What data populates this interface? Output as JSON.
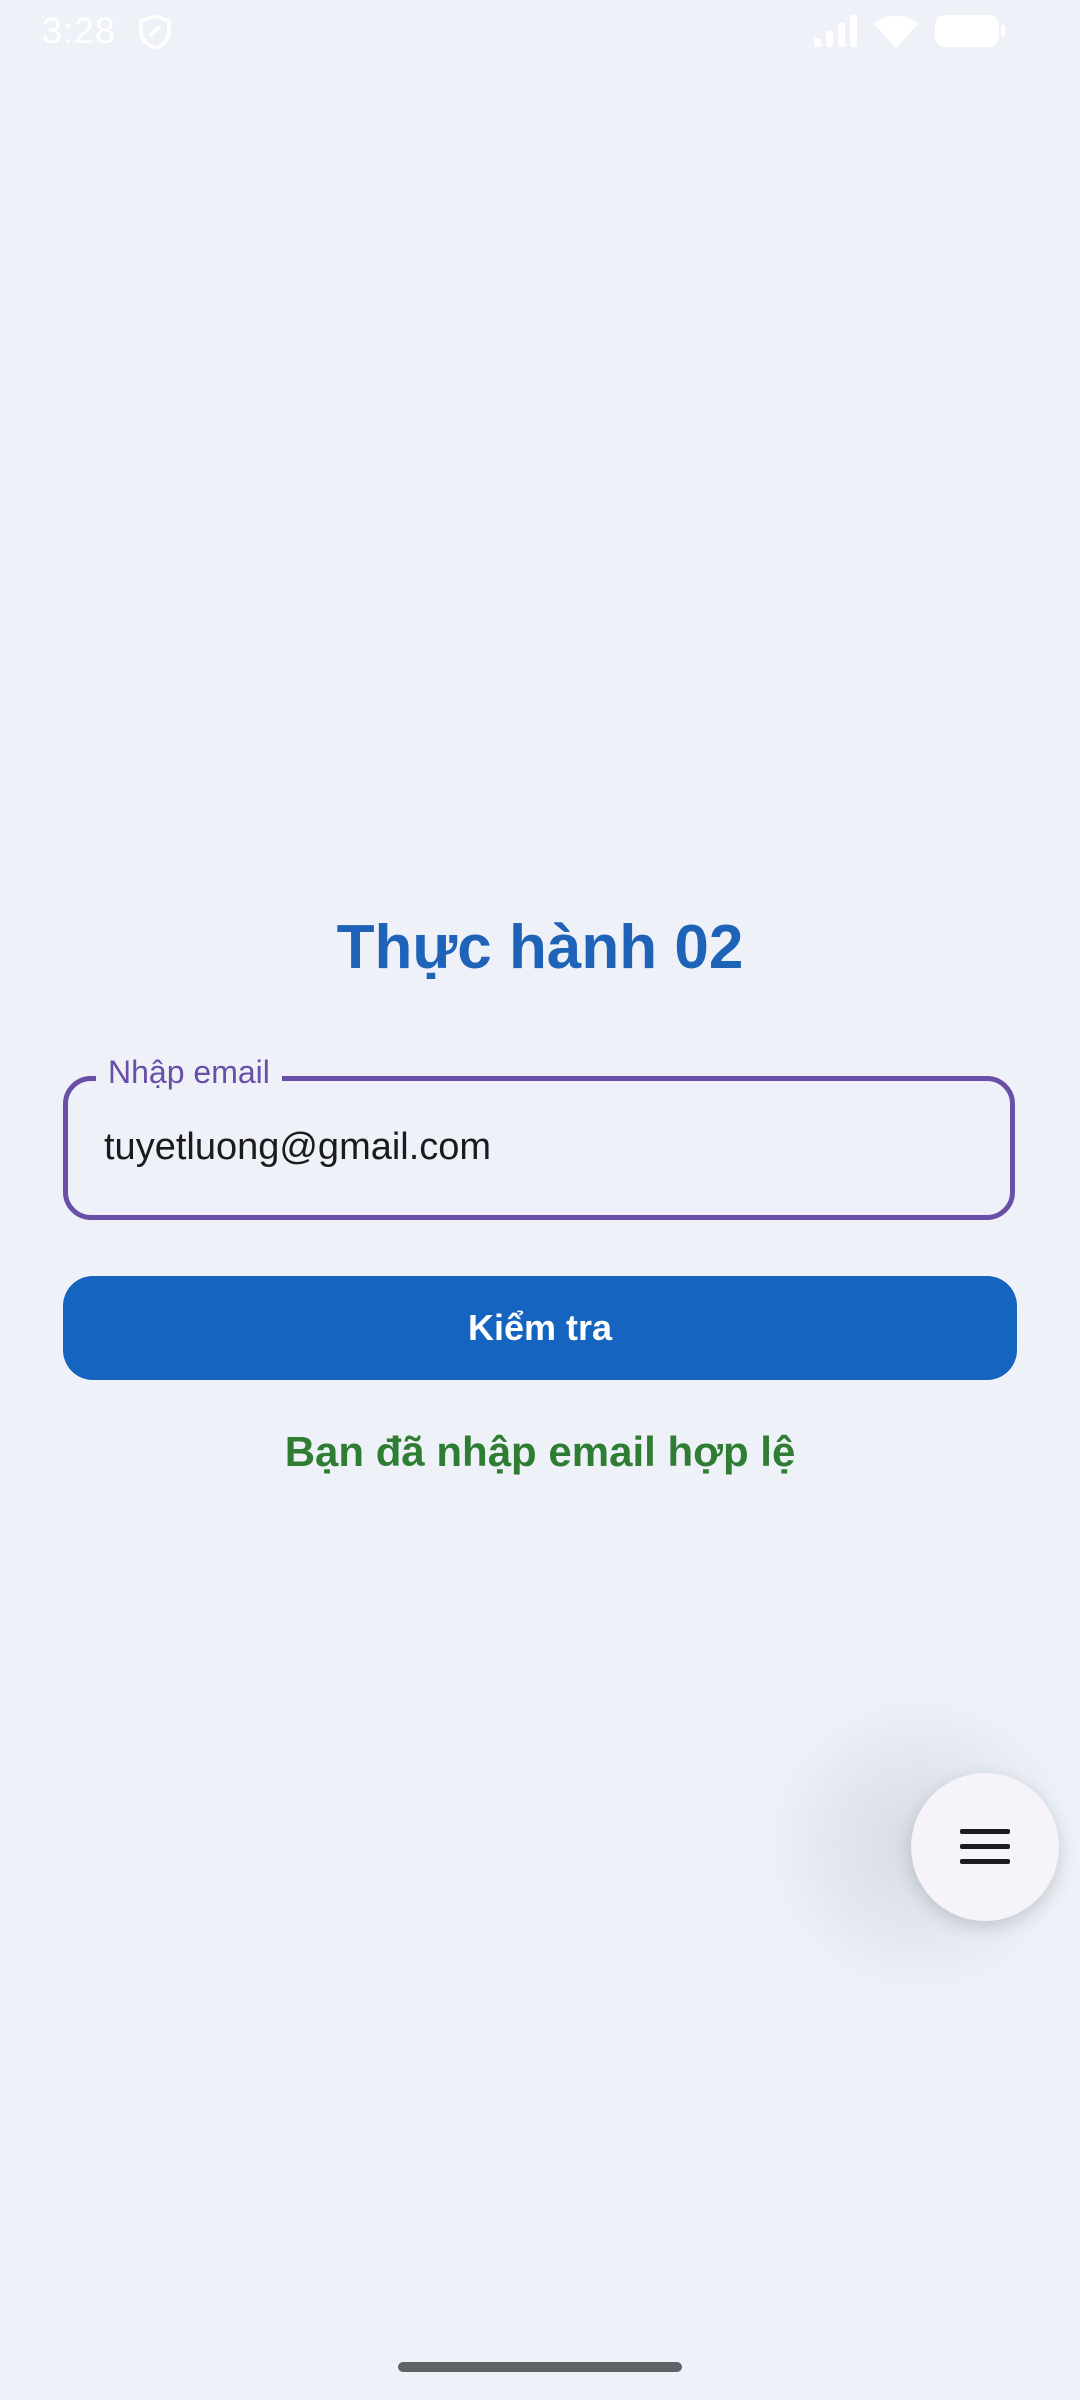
{
  "status_bar": {
    "time": "3:28",
    "icons": [
      "shield-icon",
      "signal-icon",
      "wifi-icon",
      "battery-icon"
    ]
  },
  "main": {
    "title": "Thực hành 02",
    "email_field": {
      "label": "Nhập email",
      "value": "tuyetluong@gmail.com"
    },
    "check_button_label": "Kiểm tra",
    "result_message": "Bạn đã nhập email hợp lệ"
  },
  "fab": {
    "icon": "menu-icon"
  },
  "colors": {
    "background": "#eef2f8",
    "title": "#1e63b8",
    "field_border": "#6a4fa8",
    "button": "#1565c0",
    "success": "#2e7d32"
  }
}
